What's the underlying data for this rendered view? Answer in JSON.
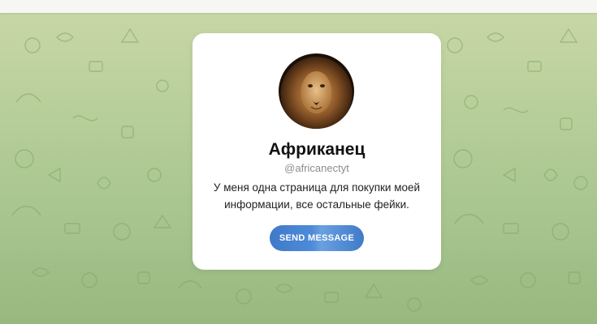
{
  "profile": {
    "name": "Африканец",
    "username": "@africanectyt",
    "bio": "У меня одна страница для покупки моей информации, все остальные фейки.",
    "avatar_icon": "lion-avatar"
  },
  "actions": {
    "send_message_label": "SEND MESSAGE"
  },
  "colors": {
    "background_top": "#c9d8a7",
    "background_bottom": "#97b87f",
    "button": "#4a85d2",
    "card": "#ffffff"
  }
}
